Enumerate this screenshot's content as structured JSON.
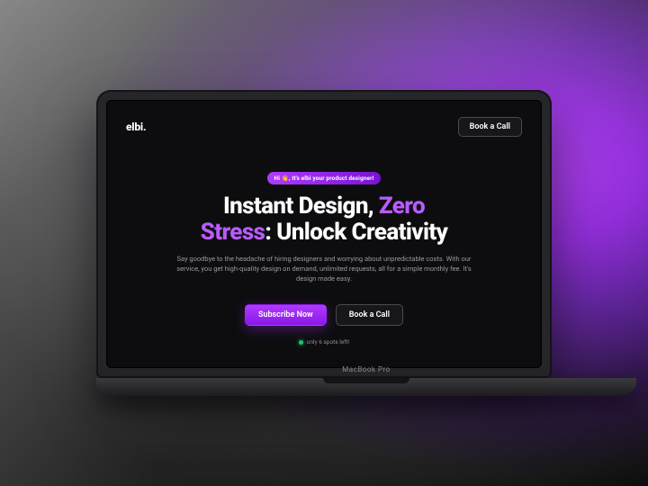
{
  "device": {
    "model_label": "MacBook Pro"
  },
  "nav": {
    "logo": "elbi.",
    "book_call_label": "Book a Call"
  },
  "hero": {
    "pill_text": "Hi 👋, It's elbi your product designer!",
    "headline_line1_prefix": "Instant Design, ",
    "headline_line1_accent": "Zero",
    "headline_line2_accent": "Stress",
    "headline_line2_suffix": ": Unlock Creativity",
    "subtext": "Say goodbye to the headache of hiring designers and worrying about unpredictable costs. With our service, you get high-quality design on demand, unlimited requests, all for a simple monthly fee. It's design made easy.",
    "subscribe_label": "Subscribe Now",
    "book_call_label": "Book a Call",
    "spots_text": "only 6 spots left!"
  },
  "colors": {
    "accent": "#b03bff",
    "background": "#0d0d0f",
    "success": "#20c36a"
  }
}
